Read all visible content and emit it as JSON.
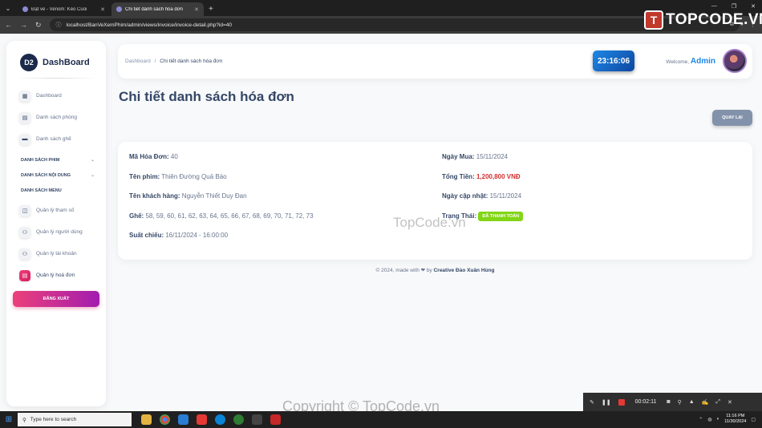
{
  "browser": {
    "tabs": [
      {
        "title": "Đặt vé - Venom: Kèo Cuối",
        "active": false
      },
      {
        "title": "Chi tiết danh sách hóa đơn",
        "active": true
      }
    ],
    "url": "localhost/BanVeXemPhim/admin/views/invoice/invoice-detail.php?id=40"
  },
  "watermark_logo": {
    "mark": "T",
    "text": "TOPCODE.VN"
  },
  "sidebar": {
    "brand": "DashBoard",
    "brand_logo": "D2",
    "items": [
      {
        "label": "Dashboard",
        "icon": "store-icon"
      },
      {
        "label": "Danh sách phòng",
        "icon": "list-icon"
      },
      {
        "label": "Danh sách ghế",
        "icon": "seat-icon"
      }
    ],
    "sections": [
      {
        "label": "DANH SÁCH PHIM"
      },
      {
        "label": "DANH SÁCH NỘI DUNG"
      },
      {
        "label": "DANH SÁCH MENU"
      }
    ],
    "menu_items": [
      {
        "label": "Quản lý tham số",
        "icon": "settings-icon"
      },
      {
        "label": "Quản lý người dùng",
        "icon": "users-icon"
      },
      {
        "label": "Quản lý tài khoản",
        "icon": "account-icon"
      },
      {
        "label": "Quản lý hoá đơn",
        "icon": "invoice-icon",
        "active": true
      }
    ],
    "logout": "ĐĂNG XUẤT"
  },
  "header": {
    "breadcrumb_root": "Dashboard",
    "breadcrumb_sep": "/",
    "breadcrumb_current": "Chi tiết danh sách hóa đơn",
    "clock": "23:16:06",
    "welcome": "Welcome,",
    "user": "Admin"
  },
  "page": {
    "title": "Chi tiết danh sách hóa đơn",
    "back_button": "QUAY LẠI"
  },
  "invoice": {
    "id_label": "Mã Hóa Đơn:",
    "id": "40",
    "movie_label": "Tên phim:",
    "movie": "Thiên Đường Quả Báo",
    "customer_label": "Tên khách hàng:",
    "customer": "Nguyễn Thiết Duy Đan",
    "seats_label": "Ghế:",
    "seats": "58, 59, 60, 61, 62, 63, 64, 65, 66, 67, 68, 69, 70, 71, 72, 73",
    "showtime_label": "Suất chiếu:",
    "showtime": "16/11/2024 - 16:00:00",
    "buy_date_label": "Ngày Mua:",
    "buy_date": "15/11/2024",
    "total_label": "Tổng Tiền:",
    "total": "1,200,800 VNĐ",
    "updated_label": "Ngày cập nhật:",
    "updated": "15/11/2024",
    "status_label": "Trạng Thái:",
    "status": "ĐÃ THANH TOÁN",
    "status_color": "#82d616"
  },
  "footer": {
    "prefix": "© 2024, made with",
    "by": "by",
    "author": "Creative Đào Xuân Hùng"
  },
  "watermarks": {
    "center": "TopCode.vn",
    "bottom": "Copyright © TopCode.vn"
  },
  "recorder": {
    "time": "00:02:11"
  },
  "taskbar": {
    "search_placeholder": "Type here to search",
    "time": "11:16 PM",
    "date": "11/30/2024"
  }
}
